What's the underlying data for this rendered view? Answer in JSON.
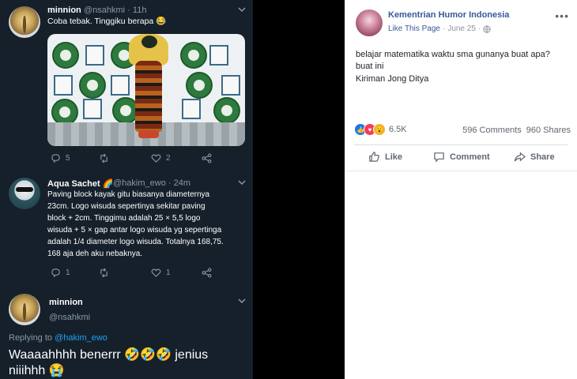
{
  "tweet1": {
    "name": "minnion",
    "handle": "@nsahkmi · 11h",
    "text": "Coba tebak. Tinggiku berapa 😂",
    "actions": {
      "reply_count": "5",
      "retweet_count": "",
      "like_count": "2"
    }
  },
  "tweet2": {
    "name": "Aqua Sachet 🌈",
    "handle": "@hakim_ewo · 24m",
    "text": "Paving block kayak gitu biasanya diameternya\n23cm. Logo wisuda sepertinya sekitar paving\nblock + 2cm. Tinggimu adalah 25 × 5,5 logo\nwisuda + 5 × gap antar logo wisuda yg sepertinga\nadalah 1/4 diameter logo wisuda. Totalnya 168,75.\n168 aja deh aku nebaknya.",
    "actions": {
      "reply_count": "1",
      "retweet_count": "",
      "like_count": "1"
    }
  },
  "tweet3": {
    "name": "minnion",
    "handle": "@nsahkmi",
    "replying_prefix": "Replying to ",
    "replying_to": "@hakim_ewo",
    "text_line1": "Waaaahhhh benerrr 🤣🤣🤣 jenius",
    "text_line2": "niiihhh 😭"
  },
  "facebook": {
    "page_name": "Kementrian Humor Indonesia",
    "like_page": "Like This Page",
    "date": "June 25",
    "more": "•••",
    "post_line1": "belajar matematika waktu sma gunanya buat apa?",
    "post_line2": "buat ini",
    "post_line3": "Kiriman Jong Ditya",
    "reaction_count": "6.5K",
    "comments": "596 Comments",
    "shares": "960 Shares",
    "btn_like": "Like",
    "btn_comment": "Comment",
    "btn_share": "Share"
  },
  "icons": {
    "reply": "reply-icon",
    "retweet": "retweet-icon",
    "like": "heart-icon",
    "share": "share-icon",
    "chevron": "chevron-down-icon",
    "globe": "globe-icon",
    "fb_like": "thumbs-up-icon",
    "fb_comment": "comment-icon",
    "fb_share": "share-arrow-icon"
  },
  "colors": {
    "twitter_bg": "#15202b",
    "twitter_link": "#1da1f2",
    "fb_link": "#385898",
    "fb_text": "#1d2129"
  }
}
